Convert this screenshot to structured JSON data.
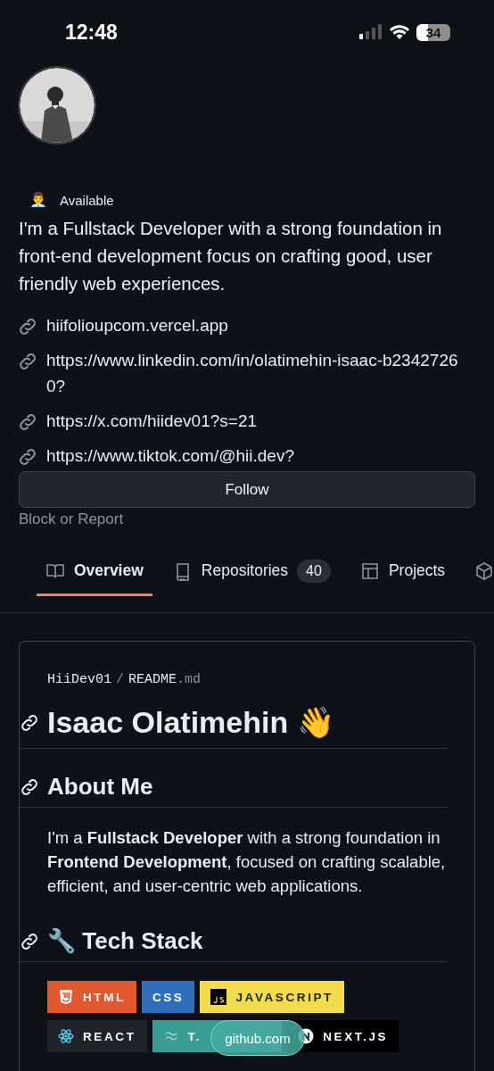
{
  "status_bar": {
    "time": "12:48",
    "battery": "34"
  },
  "profile": {
    "status_emoji": "👨‍💼",
    "status": "Available",
    "bio": "I'm a Fullstack Developer with a strong foundation in front-end development focus on crafting good, user friendly web experiences.",
    "links": [
      "hiifolioupcom.vercel.app",
      "https://www.linkedin.com/in/olatimehin-isaac-b23427260?",
      "https://x.com/hiidev01?s=21",
      "https://www.tiktok.com/@hii.dev?"
    ],
    "follow_button": "Follow",
    "block_report": "Block or Report"
  },
  "tabs": [
    {
      "kind": "book",
      "label": "Overview",
      "selected": true
    },
    {
      "kind": "repo",
      "label": "Repositories",
      "count": "40",
      "selected": false
    },
    {
      "kind": "table",
      "label": "Projects",
      "selected": false
    },
    {
      "kind": "package",
      "selected": false
    }
  ],
  "readme": {
    "owner": "HiiDev01",
    "separator": "/",
    "file": "README",
    "ext": ".md",
    "title": "Isaac Olatimehin 👋",
    "about_heading": "About Me",
    "about_text": "I'm a **Fullstack Developer** with a strong foundation in **Frontend Development**, focused on crafting scalable, efficient, and user-centric web applications.",
    "tech_heading": "🔧 Tech Stack",
    "badges": [
      {
        "kind": "html",
        "label": "HTML",
        "color": "#e0592f"
      },
      {
        "kind": "plain",
        "label": "CSS",
        "color": "#2f6ebd"
      },
      {
        "kind": "js",
        "label": "JAVASCRIPT",
        "color": "#f2dc4e"
      },
      {
        "kind": "react",
        "label": "REACT",
        "color": "#20232a"
      },
      {
        "kind": "tailwind",
        "label": "T.",
        "color": "#3a9c93"
      },
      {
        "kind": "next",
        "label": "NEXT.JS",
        "color": "#000000"
      }
    ]
  },
  "browser_pill": {
    "url": "github.com"
  }
}
